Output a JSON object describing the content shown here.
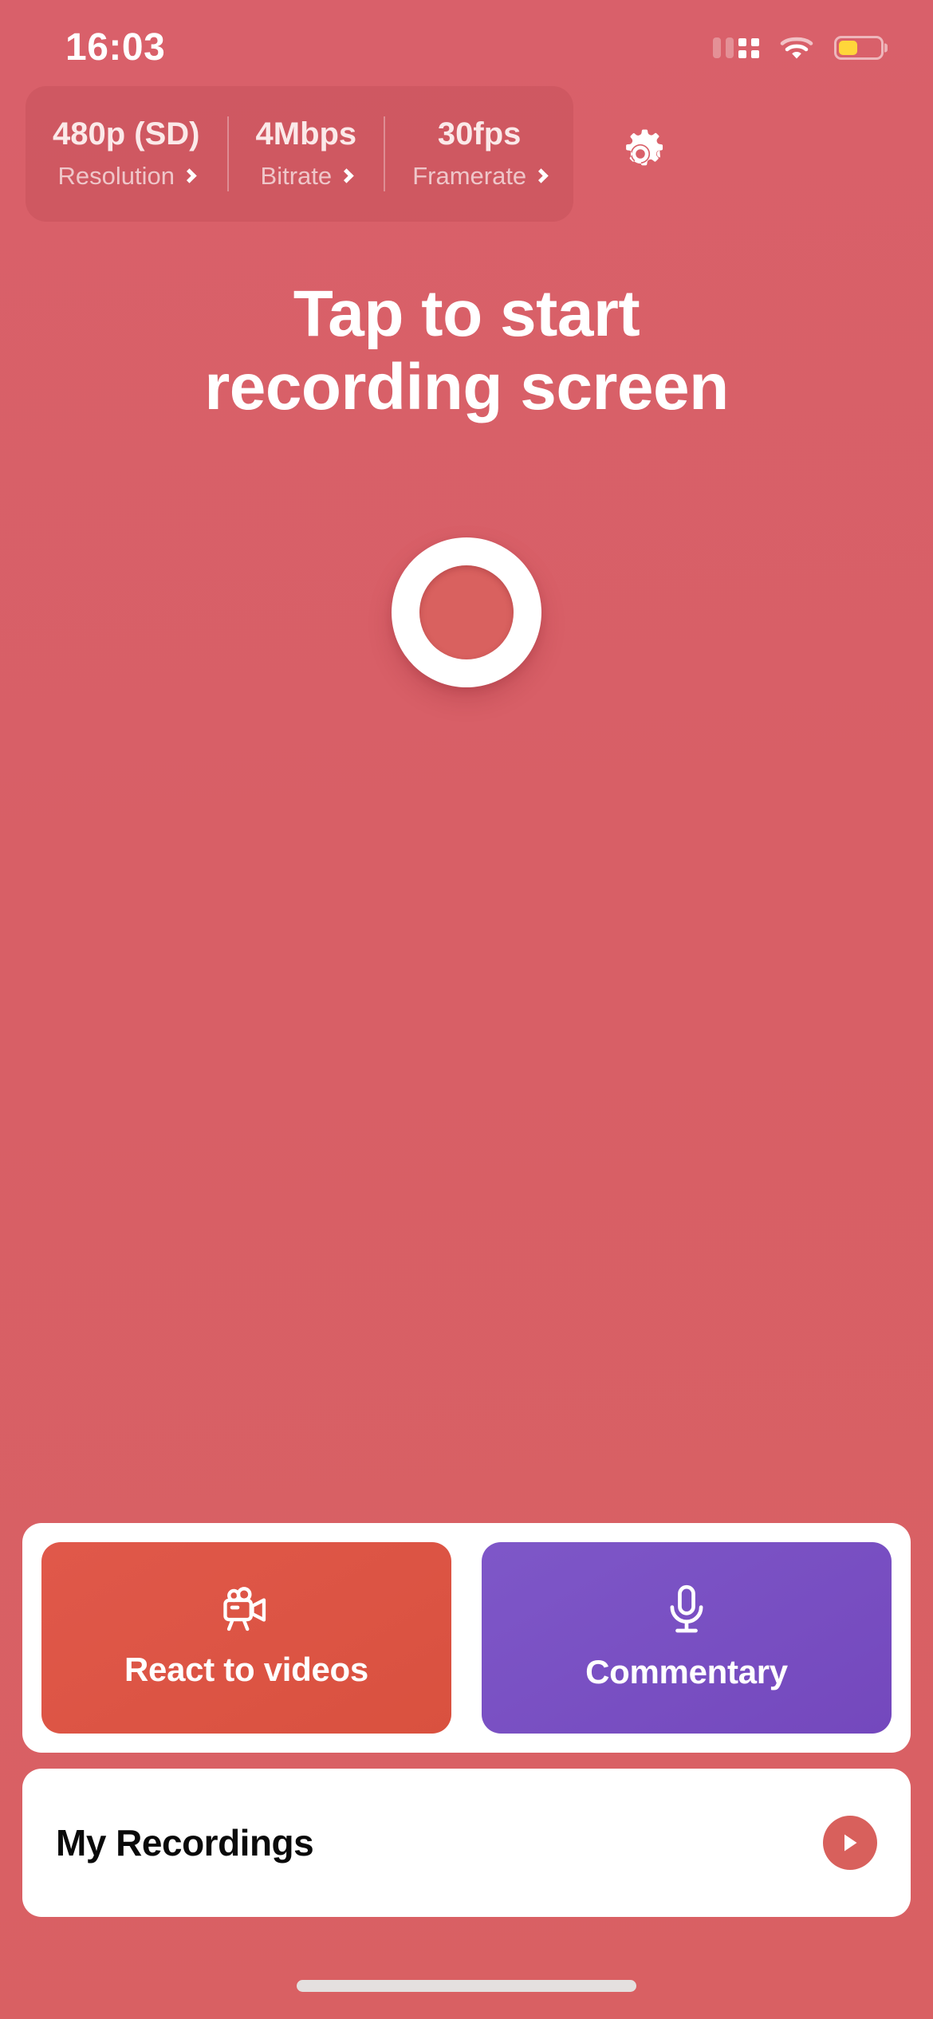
{
  "theme": {
    "background": "#d85f66",
    "accent_red": "#d9513f",
    "accent_purple": "#7448bd",
    "record_inner": "#d9615f",
    "battery_yellow": "#FFD63A",
    "card_white": "#ffffff"
  },
  "status_bar": {
    "time": "16:03",
    "cellular_icon": "cellular-signal-icon",
    "wifi_icon": "wifi-icon",
    "battery_icon": "battery-low-power-icon",
    "battery_level_percent": 46
  },
  "settings_pill": {
    "segments": [
      {
        "value": "480p (SD)",
        "label": "Resolution",
        "chevron": "chevron-right-icon"
      },
      {
        "value": "4Mbps",
        "label": "Bitrate",
        "chevron": "chevron-right-icon"
      },
      {
        "value": "30fps",
        "label": "Framerate",
        "chevron": "chevron-right-icon"
      }
    ],
    "gear_icon": "gear-icon"
  },
  "main": {
    "headline_line1": "Tap to start",
    "headline_line2": "recording screen",
    "record_button": {
      "icon": "record-circle-icon",
      "accessible_label": "Start recording"
    }
  },
  "bottom": {
    "actions": [
      {
        "label": "React to videos",
        "icon": "movie-camera-icon",
        "color": "#d9513f"
      },
      {
        "label": "Commentary",
        "icon": "microphone-icon",
        "color": "#7448bd"
      }
    ],
    "recordings": {
      "label": "My Recordings",
      "play_icon": "play-circle-icon"
    }
  },
  "home_indicator": "home-indicator-bar"
}
